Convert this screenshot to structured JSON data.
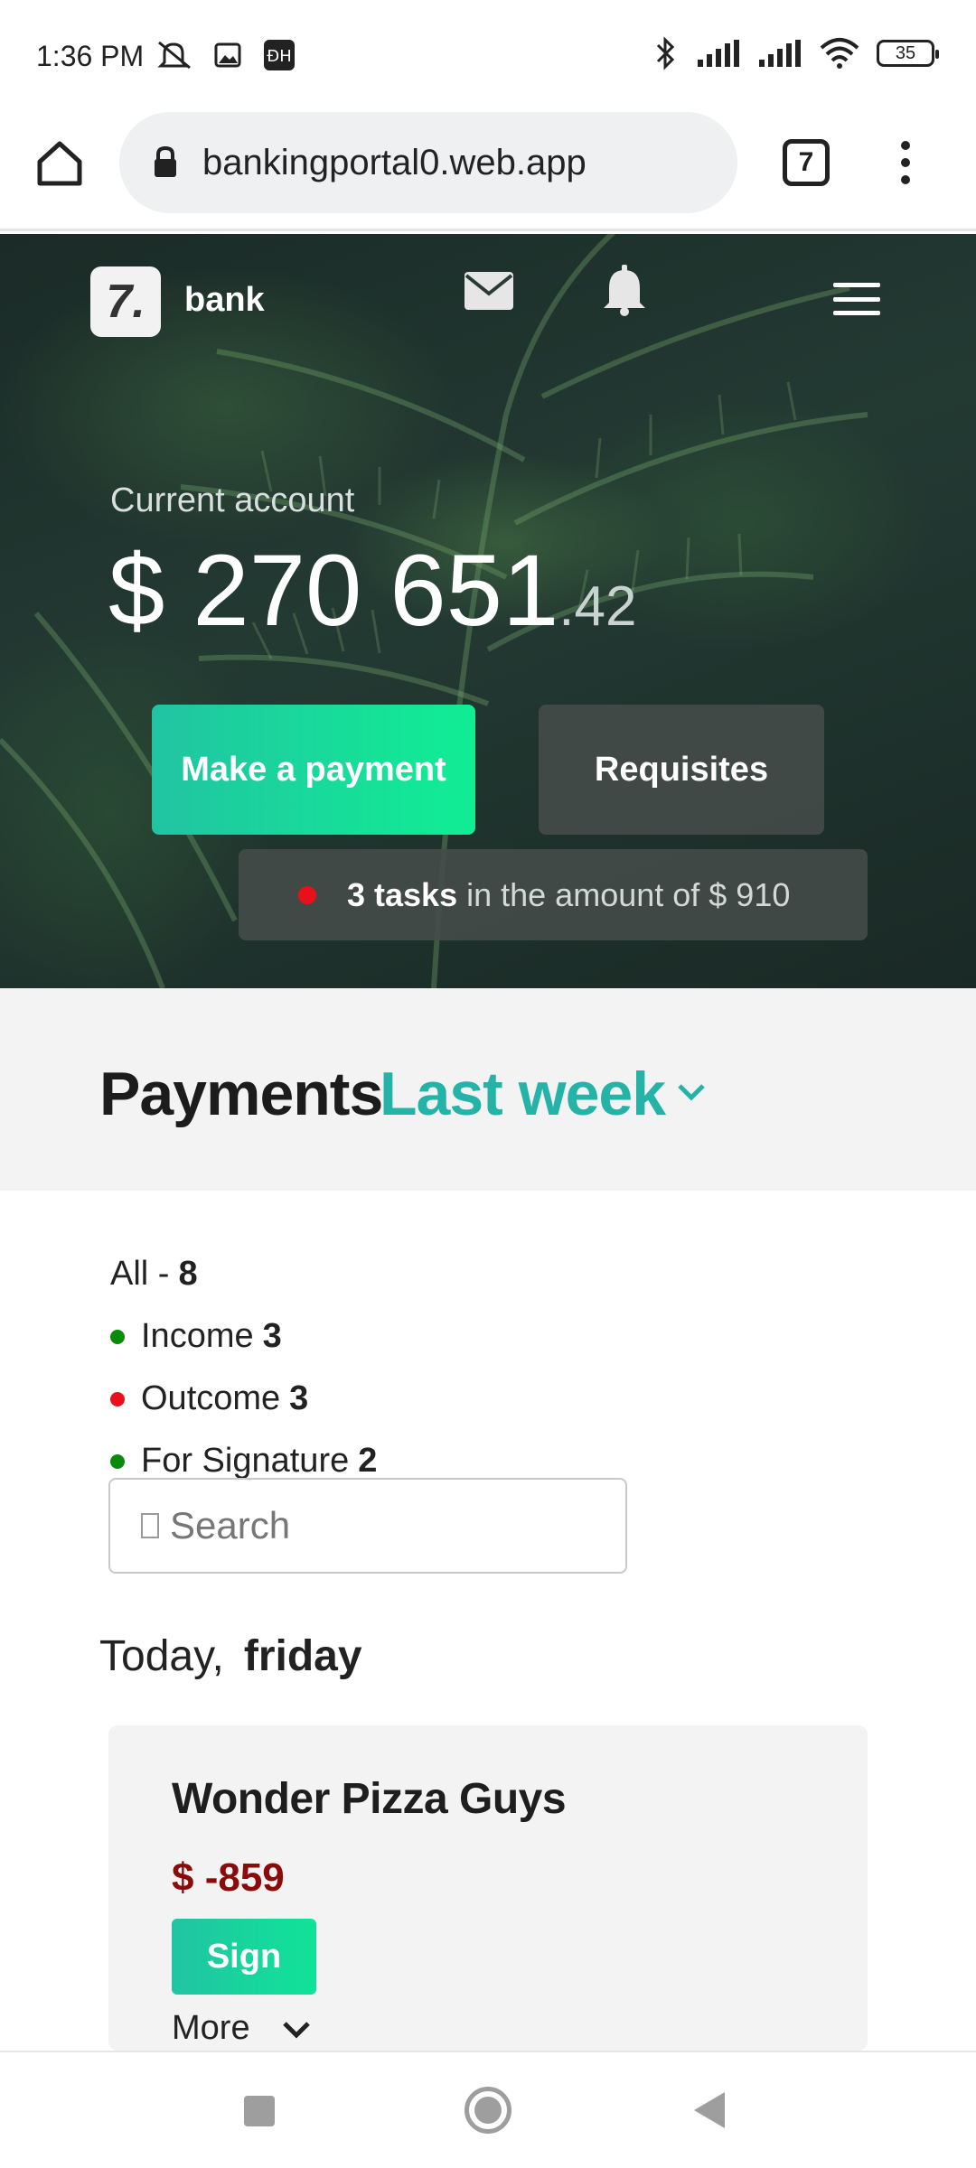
{
  "status_bar": {
    "time": "1:36 PM",
    "battery": "35"
  },
  "browser": {
    "url": "bankingportal0.web.app",
    "tab_count": "7"
  },
  "header": {
    "brand": "bank",
    "logo_text": "7."
  },
  "account": {
    "label": "Current account",
    "balance_main": "$ 270 651",
    "balance_cents": ".42"
  },
  "actions": {
    "make_payment": "Make a payment",
    "requisites": "Requisites"
  },
  "tasks": {
    "count_text": "3 tasks",
    "amount_text": "in the amount of $ 910",
    "dot_color": "#e8111b"
  },
  "payments": {
    "title": "Payments",
    "period": "Last week",
    "accent_color": "#25b3a8"
  },
  "filters": {
    "all_label": "All -",
    "all_count": "8",
    "items": [
      {
        "label": "Income",
        "count": "3",
        "color": "#0a8a0a"
      },
      {
        "label": "Outcome",
        "count": "3",
        "color": "#e8111b"
      },
      {
        "label": "For Signature",
        "count": "2",
        "color": "#0a8a0a"
      }
    ]
  },
  "search": {
    "placeholder": "Search"
  },
  "day": {
    "prefix": "Today,",
    "weekday": "friday"
  },
  "payment_card": {
    "title": "Wonder Pizza Guys",
    "amount": "$ -859",
    "sign_label": "Sign",
    "more_label": "More"
  }
}
